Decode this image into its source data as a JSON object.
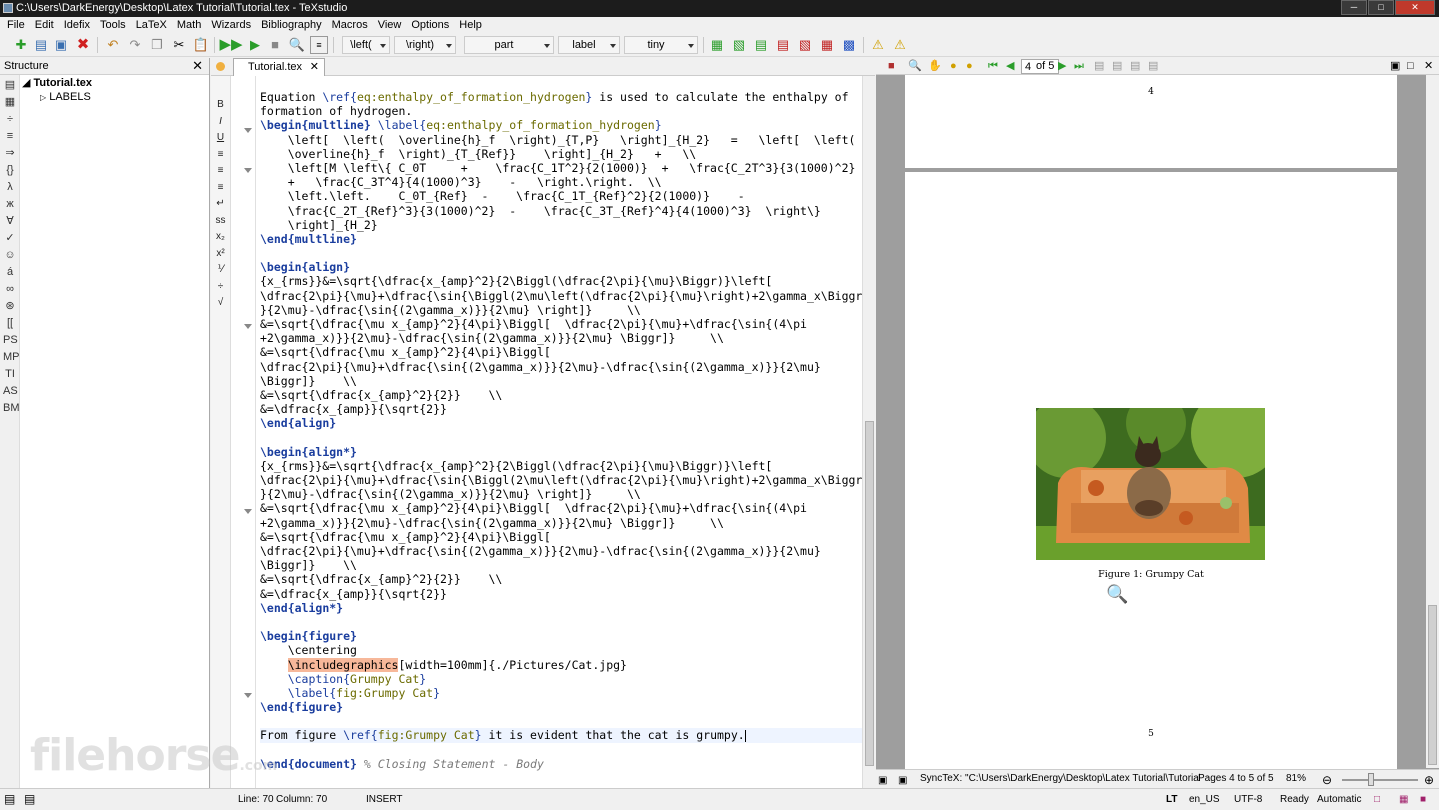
{
  "window": {
    "title": "C:\\Users\\DarkEnergy\\Desktop\\Latex Tutorial\\Tutorial.tex - TeXstudio"
  },
  "menu": [
    "File",
    "Edit",
    "Idefix",
    "Tools",
    "LaTeX",
    "Math",
    "Wizards",
    "Bibliography",
    "Macros",
    "View",
    "Options",
    "Help"
  ],
  "toolbar": {
    "left_dd": "\\left(",
    "right_dd": "\\right)",
    "section_dd": "part",
    "ref_dd": "label",
    "size_dd": "tiny"
  },
  "structure": {
    "title": "Structure",
    "root": "Tutorial.tex",
    "child": "LABELS"
  },
  "editor": {
    "tab": "Tutorial.tex",
    "lines": [
      "Equation \\ref{eq:enthalpy_of_formation_hydrogen} is used to calculate the enthalpy of",
      "formation of hydrogen.",
      "\\begin{multline} \\label{eq:enthalpy_of_formation_hydrogen}",
      "    \\left[  \\left(  \\overline{h}_f  \\right)_{T,P}   \\right]_{H_2}   =   \\left[  \\left(",
      "    \\overline{h}_f  \\right)_{T_{Ref}}    \\right]_{H_2}   +   \\\\",
      "    \\left[M \\left\\{ C_0T     +    \\frac{C_1T^2}{2(1000)}  +   \\frac{C_2T^3}{3(1000)^2}",
      "    +   \\frac{C_3T^4}{4(1000)^3}    -   \\right.\\right.  \\\\",
      "    \\left.\\left.    C_0T_{Ref}  -    \\frac{C_1T_{Ref}^2}{2(1000)}    -",
      "    \\frac{C_2T_{Ref}^3}{3(1000)^2}  -    \\frac{C_3T_{Ref}^4}{4(1000)^3}  \\right\\}",
      "    \\right]_{H_2}",
      "\\end{multline}",
      "",
      "\\begin{align}",
      "{x_{rms}}&=\\sqrt{\\dfrac{x_{amp}^2}{2\\Biggl(\\dfrac{2\\pi}{\\mu}\\Biggr)}\\left[",
      "\\dfrac{2\\pi}{\\mu}+\\dfrac{\\sin{\\Biggl(2\\mu\\left(\\dfrac{2\\pi}{\\mu}\\right)+2\\gamma_x\\Biggr)}",
      "}{2\\mu}-\\dfrac{\\sin{(2\\gamma_x)}}{2\\mu} \\right]}     \\\\",
      "&=\\sqrt{\\dfrac{\\mu x_{amp}^2}{4\\pi}\\Biggl[  \\dfrac{2\\pi}{\\mu}+\\dfrac{\\sin{(4\\pi",
      "+2\\gamma_x)}}{2\\mu}-\\dfrac{\\sin{(2\\gamma_x)}}{2\\mu} \\Biggr]}     \\\\",
      "&=\\sqrt{\\dfrac{\\mu x_{amp}^2}{4\\pi}\\Biggl[",
      "\\dfrac{2\\pi}{\\mu}+\\dfrac{\\sin{(2\\gamma_x)}}{2\\mu}-\\dfrac{\\sin{(2\\gamma_x)}}{2\\mu}",
      "\\Biggr]}    \\\\",
      "&=\\sqrt{\\dfrac{x_{amp}^2}{2}}    \\\\",
      "&=\\dfrac{x_{amp}}{\\sqrt{2}}",
      "\\end{align}",
      "",
      "\\begin{align*}",
      "{x_{rms}}&=\\sqrt{\\dfrac{x_{amp}^2}{2\\Biggl(\\dfrac{2\\pi}{\\mu}\\Biggr)}\\left[",
      "\\dfrac{2\\pi}{\\mu}+\\dfrac{\\sin{\\Biggl(2\\mu\\left(\\dfrac{2\\pi}{\\mu}\\right)+2\\gamma_x\\Biggr)}",
      "}{2\\mu}-\\dfrac{\\sin{(2\\gamma_x)}}{2\\mu} \\right]}     \\\\",
      "&=\\sqrt{\\dfrac{\\mu x_{amp}^2}{4\\pi}\\Biggl[  \\dfrac{2\\pi}{\\mu}+\\dfrac{\\sin{(4\\pi",
      "+2\\gamma_x)}}{2\\mu}-\\dfrac{\\sin{(2\\gamma_x)}}{2\\mu} \\Biggr]}     \\\\",
      "&=\\sqrt{\\dfrac{\\mu x_{amp}^2}{4\\pi}\\Biggl[",
      "\\dfrac{2\\pi}{\\mu}+\\dfrac{\\sin{(2\\gamma_x)}}{2\\mu}-\\dfrac{\\sin{(2\\gamma_x)}}{2\\mu}",
      "\\Biggr]}    \\\\",
      "&=\\sqrt{\\dfrac{x_{amp}^2}{2}}    \\\\",
      "&=\\dfrac{x_{amp}}{\\sqrt{2}}",
      "\\end{align*}",
      "",
      "\\begin{figure}",
      "    \\centering",
      "    \\includegraphics[width=100mm]{./Pictures/Cat.jpg}",
      "    \\caption{Grumpy Cat}",
      "    \\label{fig:Grumpy Cat}",
      "\\end{figure}",
      "",
      "From figure \\ref{fig:Grumpy Cat} it is evident that the cat is grumpy.",
      "",
      "\\end{document} % Closing Statement - Body"
    ]
  },
  "pdf": {
    "page_input": "4",
    "page_of": "of 5",
    "page_top_num": "4",
    "page_bottom_num": "5",
    "caption": "Figure 1: Grumpy Cat",
    "synctex": "SyncTeX: \"C:\\Users\\DarkEnergy\\Desktop\\Latex Tutorial\\Tutorial",
    "pages": "Pages 4 to 5 of 5",
    "zoom": "81%"
  },
  "status": {
    "line": "Line: 70",
    "column": "Column: 70",
    "mode": "INSERT",
    "lang": "en_US",
    "encoding": "UTF-8",
    "state": "Ready",
    "automatic": "Automatic",
    "lt": "LT"
  },
  "watermark": {
    "brand": "filehorse",
    "tld": ".com"
  }
}
